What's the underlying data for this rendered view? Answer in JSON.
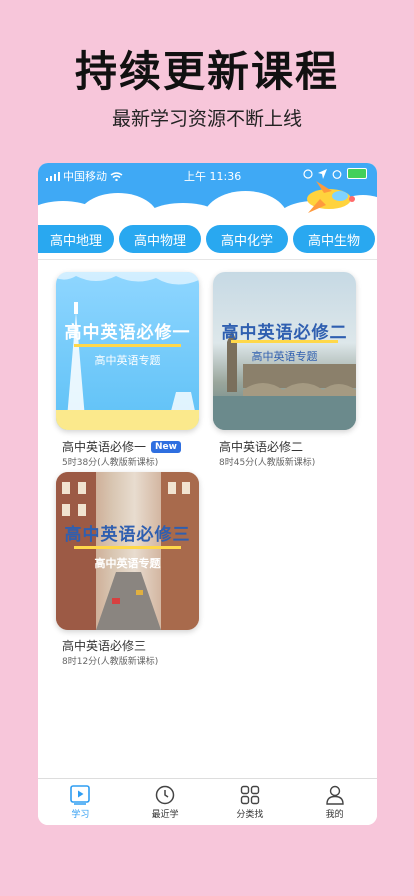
{
  "promo": {
    "headline": "持续更新课程",
    "subline": "最新学习资源不断上线"
  },
  "status_bar": {
    "carrier": "中国移动",
    "time": "上午 11:36"
  },
  "tabs": [
    {
      "label": "高中地理"
    },
    {
      "label": "高中物理"
    },
    {
      "label": "高中化学"
    },
    {
      "label": "高中生物"
    }
  ],
  "courses": [
    {
      "title": "高中英语必修一",
      "badge": "New",
      "meta": "5时38分(人教版新课标)",
      "cover_title": "高中英语必修一",
      "cover_sub": "高中英语专题"
    },
    {
      "title": "高中英语必修二",
      "meta": "8时45分(人教版新课标)",
      "cover_title": "高中英语必修二",
      "cover_sub": "高中英语专题"
    },
    {
      "title": "高中英语必修三",
      "meta": "8时12分(人教版新课标)",
      "cover_title": "高中英语必修三",
      "cover_sub": "高中英语专题"
    }
  ],
  "bottom_nav": [
    {
      "label": "学习",
      "icon": "play-icon",
      "active": true
    },
    {
      "label": "最近学",
      "icon": "clock-icon"
    },
    {
      "label": "分类找",
      "icon": "grid-icon"
    },
    {
      "label": "我的",
      "icon": "person-icon"
    }
  ],
  "colors": {
    "background": "#f7c6da",
    "accent": "#29a8f0",
    "active_nav": "#2f9df2"
  }
}
